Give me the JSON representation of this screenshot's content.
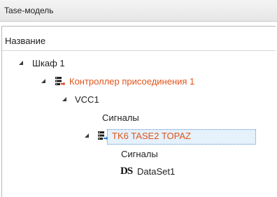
{
  "panel": {
    "title": "Tase-модель"
  },
  "tree": {
    "column_header": "Название",
    "nodes": [
      {
        "label": "Шкаф 1",
        "expanded": true,
        "icon": null
      },
      {
        "label": "Контроллер присоединения 1",
        "expanded": true,
        "icon": "controller-icon",
        "color": "#e0541b"
      },
      {
        "label": "VCC1",
        "expanded": true,
        "icon": null
      },
      {
        "label": "Сигналы",
        "expanded": false,
        "icon": null
      },
      {
        "label": "TK6 TASE2 TOPAZ",
        "expanded": true,
        "icon": "controller-link-icon",
        "color": "#e0541b",
        "selected": true
      },
      {
        "label": "Сигналы",
        "expanded": false,
        "icon": null
      },
      {
        "label": "DataSet1",
        "expanded": false,
        "icon": "dataset-icon",
        "icon_text": "DS"
      }
    ]
  }
}
